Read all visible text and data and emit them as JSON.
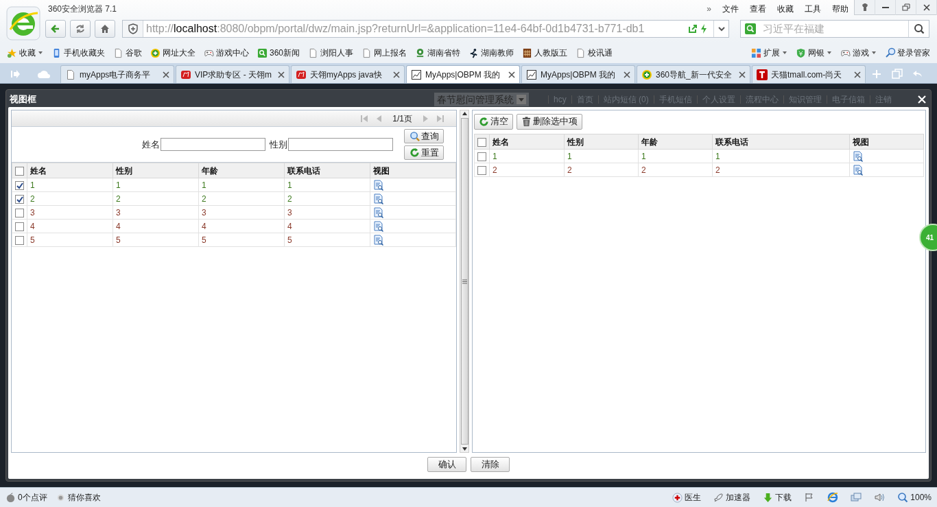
{
  "browser": {
    "title": "360安全浏览器 7.1",
    "menu": [
      "»",
      "文件",
      "查看",
      "收藏",
      "工具",
      "帮助"
    ],
    "url": {
      "scheme": "http://",
      "host": "localhost",
      "rest": ":8080/obpm/portal/dwz/main.jsp?returnUrl=&application=11e4-64bf-0d1b4731-b771-db1"
    },
    "search": {
      "placeholder": "习近平在福建"
    },
    "bookmarks": [
      {
        "label": "收藏",
        "kind": "star",
        "dropdown": true
      },
      {
        "label": "手机收藏夹",
        "kind": "phone",
        "dropdown": false
      },
      {
        "label": "谷歌",
        "kind": "page",
        "dropdown": false
      },
      {
        "label": "网址大全",
        "kind": "plus",
        "dropdown": false
      },
      {
        "label": "游戏中心",
        "kind": "gamepad",
        "dropdown": false
      },
      {
        "label": "360新闻",
        "kind": "search",
        "dropdown": false
      },
      {
        "label": "浏阳人事",
        "kind": "page",
        "dropdown": false
      },
      {
        "label": "网上报名",
        "kind": "page",
        "dropdown": false
      },
      {
        "label": "湖南省特",
        "kind": "leaf",
        "dropdown": false
      },
      {
        "label": "湖南教师",
        "kind": "runner",
        "dropdown": false
      },
      {
        "label": "人教版五",
        "kind": "grid",
        "dropdown": false
      },
      {
        "label": "校讯通",
        "kind": "page",
        "dropdown": false
      }
    ],
    "tools": [
      {
        "label": "扩展",
        "kind": "blocks"
      },
      {
        "label": "网银",
        "kind": "shield"
      },
      {
        "label": "游戏",
        "kind": "gamepad"
      }
    ],
    "login": "登录管家",
    "tabs": [
      {
        "label": "myApps电子商务平",
        "kind": "page",
        "selected": false
      },
      {
        "label": "VIP求助专区 - 天翎m",
        "kind": "red",
        "selected": false
      },
      {
        "label": "天翎myApps java快",
        "kind": "red",
        "selected": false
      },
      {
        "label": "MyApps|OBPM 我的",
        "kind": "chart",
        "selected": true
      },
      {
        "label": "MyApps|OBPM 我的",
        "kind": "chart",
        "selected": false
      },
      {
        "label": "360导航_新一代安全",
        "kind": "plus",
        "selected": false
      },
      {
        "label": "天猫tmall.com-尚天",
        "kind": "tmall",
        "selected": false
      }
    ]
  },
  "app_header": {
    "system": "春节慰问管理系统",
    "nav": [
      "hcy",
      "首页",
      "站内短信 (0)",
      "手机短信",
      "个人设置",
      "流程中心",
      "知识管理",
      "电子信箱",
      "注销"
    ]
  },
  "dialog": {
    "title": "视图框",
    "left": {
      "pager": "1/1页",
      "filters": [
        {
          "label": "姓名"
        },
        {
          "label": "性别"
        }
      ],
      "buttons": [
        {
          "label": "查询",
          "kind": "magnifier"
        },
        {
          "label": "重置",
          "kind": "refresh"
        }
      ],
      "all_checked": false,
      "columns": [
        "姓名",
        "性别",
        "年龄",
        "联系电话",
        "视图"
      ],
      "rows": [
        {
          "checked": true,
          "color": "#3d7a1e",
          "cells": [
            "1",
            "1",
            "1",
            "1"
          ]
        },
        {
          "checked": true,
          "color": "#3d7a1e",
          "cells": [
            "2",
            "2",
            "2",
            "2"
          ]
        },
        {
          "checked": false,
          "color": "#8b3a2b",
          "cells": [
            "3",
            "3",
            "3",
            "3"
          ]
        },
        {
          "checked": false,
          "color": "#8b3a2b",
          "cells": [
            "4",
            "4",
            "4",
            "4"
          ]
        },
        {
          "checked": false,
          "color": "#8b3a2b",
          "cells": [
            "5",
            "5",
            "5",
            "5"
          ]
        }
      ]
    },
    "right": {
      "buttons": [
        {
          "label": "清空",
          "kind": "refresh"
        },
        {
          "label": "删除选中项",
          "kind": "trash"
        }
      ],
      "all_checked": false,
      "columns": [
        "姓名",
        "性别",
        "年龄",
        "联系电话",
        "视图"
      ],
      "rows": [
        {
          "checked": false,
          "color": "#3d7a1e",
          "cells": [
            "1",
            "1",
            "1",
            "1"
          ]
        },
        {
          "checked": false,
          "color": "#8b3a2b",
          "cells": [
            "2",
            "2",
            "2",
            "2"
          ]
        }
      ]
    },
    "footer_buttons": [
      "确认",
      "清除"
    ]
  },
  "side_badge": "41",
  "status_bar": {
    "left": [
      {
        "label": "0个点评",
        "kind": "apple"
      },
      {
        "label": "猜你喜欢",
        "kind": "dot"
      }
    ],
    "right": [
      {
        "label": "医生",
        "kind": "doctor"
      },
      {
        "label": "加速器",
        "kind": "rocket"
      },
      {
        "label": "下载",
        "kind": "download"
      }
    ],
    "zoom": "100%"
  }
}
